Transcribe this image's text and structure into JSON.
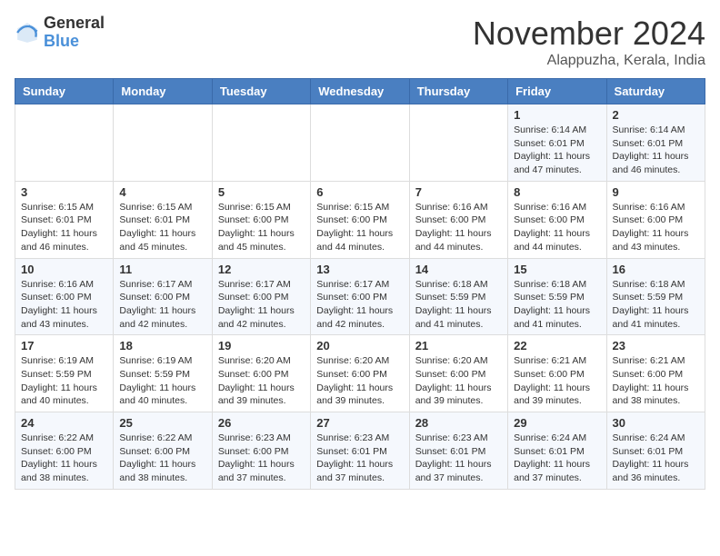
{
  "header": {
    "logo_general": "General",
    "logo_blue": "Blue",
    "month": "November 2024",
    "location": "Alappuzha, Kerala, India"
  },
  "days_of_week": [
    "Sunday",
    "Monday",
    "Tuesday",
    "Wednesday",
    "Thursday",
    "Friday",
    "Saturday"
  ],
  "weeks": [
    [
      {
        "day": "",
        "content": ""
      },
      {
        "day": "",
        "content": ""
      },
      {
        "day": "",
        "content": ""
      },
      {
        "day": "",
        "content": ""
      },
      {
        "day": "",
        "content": ""
      },
      {
        "day": "1",
        "content": "Sunrise: 6:14 AM\nSunset: 6:01 PM\nDaylight: 11 hours and 47 minutes."
      },
      {
        "day": "2",
        "content": "Sunrise: 6:14 AM\nSunset: 6:01 PM\nDaylight: 11 hours and 46 minutes."
      }
    ],
    [
      {
        "day": "3",
        "content": "Sunrise: 6:15 AM\nSunset: 6:01 PM\nDaylight: 11 hours and 46 minutes."
      },
      {
        "day": "4",
        "content": "Sunrise: 6:15 AM\nSunset: 6:01 PM\nDaylight: 11 hours and 45 minutes."
      },
      {
        "day": "5",
        "content": "Sunrise: 6:15 AM\nSunset: 6:00 PM\nDaylight: 11 hours and 45 minutes."
      },
      {
        "day": "6",
        "content": "Sunrise: 6:15 AM\nSunset: 6:00 PM\nDaylight: 11 hours and 44 minutes."
      },
      {
        "day": "7",
        "content": "Sunrise: 6:16 AM\nSunset: 6:00 PM\nDaylight: 11 hours and 44 minutes."
      },
      {
        "day": "8",
        "content": "Sunrise: 6:16 AM\nSunset: 6:00 PM\nDaylight: 11 hours and 44 minutes."
      },
      {
        "day": "9",
        "content": "Sunrise: 6:16 AM\nSunset: 6:00 PM\nDaylight: 11 hours and 43 minutes."
      }
    ],
    [
      {
        "day": "10",
        "content": "Sunrise: 6:16 AM\nSunset: 6:00 PM\nDaylight: 11 hours and 43 minutes."
      },
      {
        "day": "11",
        "content": "Sunrise: 6:17 AM\nSunset: 6:00 PM\nDaylight: 11 hours and 42 minutes."
      },
      {
        "day": "12",
        "content": "Sunrise: 6:17 AM\nSunset: 6:00 PM\nDaylight: 11 hours and 42 minutes."
      },
      {
        "day": "13",
        "content": "Sunrise: 6:17 AM\nSunset: 6:00 PM\nDaylight: 11 hours and 42 minutes."
      },
      {
        "day": "14",
        "content": "Sunrise: 6:18 AM\nSunset: 5:59 PM\nDaylight: 11 hours and 41 minutes."
      },
      {
        "day": "15",
        "content": "Sunrise: 6:18 AM\nSunset: 5:59 PM\nDaylight: 11 hours and 41 minutes."
      },
      {
        "day": "16",
        "content": "Sunrise: 6:18 AM\nSunset: 5:59 PM\nDaylight: 11 hours and 41 minutes."
      }
    ],
    [
      {
        "day": "17",
        "content": "Sunrise: 6:19 AM\nSunset: 5:59 PM\nDaylight: 11 hours and 40 minutes."
      },
      {
        "day": "18",
        "content": "Sunrise: 6:19 AM\nSunset: 5:59 PM\nDaylight: 11 hours and 40 minutes."
      },
      {
        "day": "19",
        "content": "Sunrise: 6:20 AM\nSunset: 6:00 PM\nDaylight: 11 hours and 39 minutes."
      },
      {
        "day": "20",
        "content": "Sunrise: 6:20 AM\nSunset: 6:00 PM\nDaylight: 11 hours and 39 minutes."
      },
      {
        "day": "21",
        "content": "Sunrise: 6:20 AM\nSunset: 6:00 PM\nDaylight: 11 hours and 39 minutes."
      },
      {
        "day": "22",
        "content": "Sunrise: 6:21 AM\nSunset: 6:00 PM\nDaylight: 11 hours and 39 minutes."
      },
      {
        "day": "23",
        "content": "Sunrise: 6:21 AM\nSunset: 6:00 PM\nDaylight: 11 hours and 38 minutes."
      }
    ],
    [
      {
        "day": "24",
        "content": "Sunrise: 6:22 AM\nSunset: 6:00 PM\nDaylight: 11 hours and 38 minutes."
      },
      {
        "day": "25",
        "content": "Sunrise: 6:22 AM\nSunset: 6:00 PM\nDaylight: 11 hours and 38 minutes."
      },
      {
        "day": "26",
        "content": "Sunrise: 6:23 AM\nSunset: 6:00 PM\nDaylight: 11 hours and 37 minutes."
      },
      {
        "day": "27",
        "content": "Sunrise: 6:23 AM\nSunset: 6:01 PM\nDaylight: 11 hours and 37 minutes."
      },
      {
        "day": "28",
        "content": "Sunrise: 6:23 AM\nSunset: 6:01 PM\nDaylight: 11 hours and 37 minutes."
      },
      {
        "day": "29",
        "content": "Sunrise: 6:24 AM\nSunset: 6:01 PM\nDaylight: 11 hours and 37 minutes."
      },
      {
        "day": "30",
        "content": "Sunrise: 6:24 AM\nSunset: 6:01 PM\nDaylight: 11 hours and 36 minutes."
      }
    ]
  ]
}
